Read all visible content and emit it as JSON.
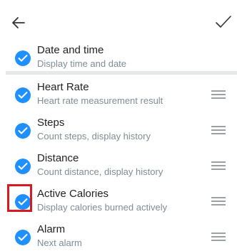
{
  "colors": {
    "accent": "#1e90ff",
    "highlight": "#d71920"
  },
  "header": {
    "back_icon": "arrow-left-icon",
    "done_icon": "checkmark-icon"
  },
  "fixed_item": {
    "title": "Date and time",
    "subtitle": "Display time and date",
    "checked": true
  },
  "items": [
    {
      "title": "Heart Rate",
      "subtitle": "Heart rate measurement result",
      "checked": true
    },
    {
      "title": "Steps",
      "subtitle": "Count steps, display history",
      "checked": true
    },
    {
      "title": "Distance",
      "subtitle": "Count distance, display history",
      "checked": true
    },
    {
      "title": "Active Calories",
      "subtitle": "Display calories burned actively",
      "checked": true
    },
    {
      "title": "Alarm",
      "subtitle": "Next alarm",
      "checked": true
    }
  ]
}
